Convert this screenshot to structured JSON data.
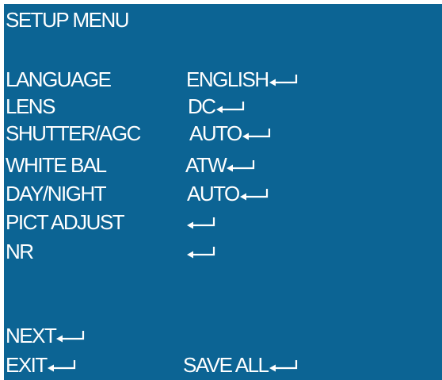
{
  "menu": {
    "title": "SETUP MENU",
    "items": [
      {
        "label": "LANGUAGE",
        "value": "ENGLISH"
      },
      {
        "label": "LENS",
        "value": "DC"
      },
      {
        "label": "SHUTTER/AGC",
        "value": "AUTO"
      },
      {
        "label": "WHITE BAL",
        "value": "ATW"
      },
      {
        "label": "DAY/NIGHT",
        "value": "AUTO"
      },
      {
        "label": "PICT ADJUST",
        "value": ""
      },
      {
        "label": "NR",
        "value": ""
      }
    ],
    "next_label": "NEXT",
    "exit_label": "EXIT",
    "save_all_label": "SAVE ALL",
    "enter_icon": "enter-arrow-icon"
  },
  "colors": {
    "background": "#0c6494",
    "text": "#ffffff",
    "border": "#ffffff"
  }
}
